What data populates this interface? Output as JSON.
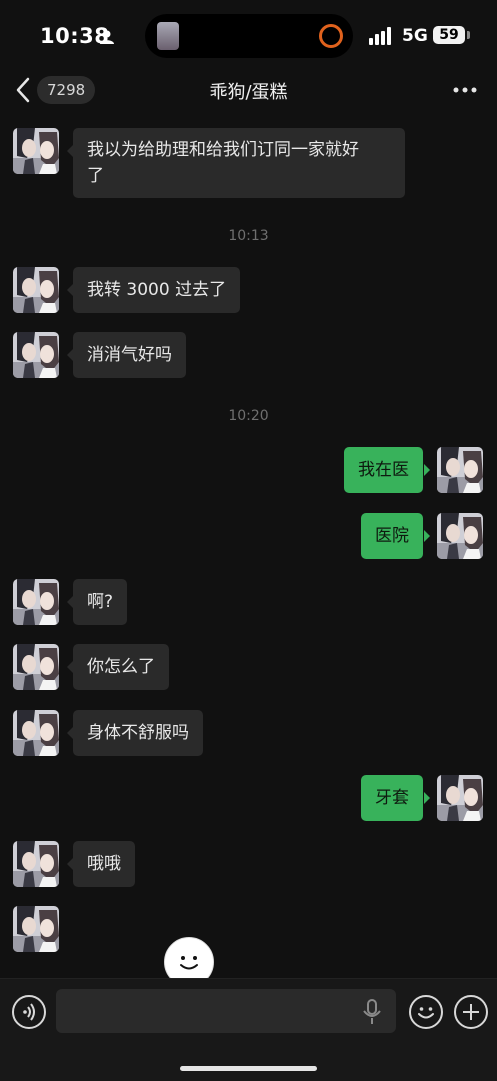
{
  "status": {
    "time": "10:38",
    "network": "5G",
    "battery": "59"
  },
  "nav": {
    "unread_count": "7298",
    "title": "乖狗/蛋糕"
  },
  "messages": [
    {
      "side": "in",
      "text": "我以为给助理和给我们订同一家就好",
      "text2": "了"
    },
    {
      "side": "stamp",
      "text": "10:13"
    },
    {
      "side": "in",
      "text": "我转 3000 过去了"
    },
    {
      "side": "in",
      "text": "消消气好吗"
    },
    {
      "side": "stamp",
      "text": "10:20"
    },
    {
      "side": "out",
      "text": "我在医"
    },
    {
      "side": "out",
      "text": "医院"
    },
    {
      "side": "in",
      "text": "啊?"
    },
    {
      "side": "in",
      "text": "你怎么了"
    },
    {
      "side": "in",
      "text": "身体不舒服吗"
    },
    {
      "side": "out",
      "text": "牙套"
    },
    {
      "side": "in",
      "text": "哦哦"
    }
  ],
  "input": {
    "placeholder": ""
  },
  "colors": {
    "accent": "#38b25b",
    "background": "#111111",
    "bubble_in": "#2a2a2a"
  },
  "icons": [
    "person-icon",
    "back-chevron-icon",
    "more-dots-icon",
    "voice-icon",
    "mic-icon",
    "emoji-icon",
    "plus-icon",
    "smile-face-icon"
  ]
}
